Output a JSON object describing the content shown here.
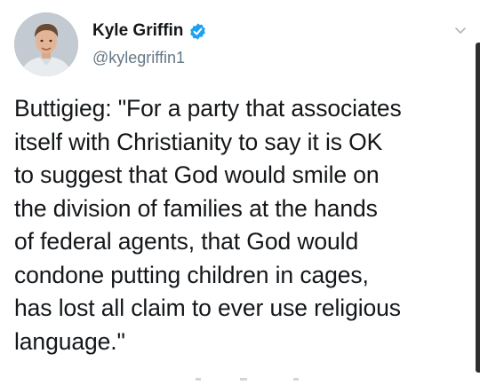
{
  "tweet": {
    "author": {
      "display_name": "Kyle Griffin",
      "handle": "@kylegriffin1",
      "verified": true,
      "avatar_icon": "user-avatar"
    },
    "text": "Buttigieg: \"For a party that associates\nitself with Christianity to say it is OK\nto suggest that God would smile on\nthe division of families at the hands\nof federal agents, that God would\ncondone putting children in cages,\nhas lost all claim to ever use religious\nlanguage.\"",
    "menu_icon": "chevron-down-icon"
  },
  "colors": {
    "verified_blue": "#1da1f2",
    "text": "#14171a",
    "secondary": "#657786"
  }
}
